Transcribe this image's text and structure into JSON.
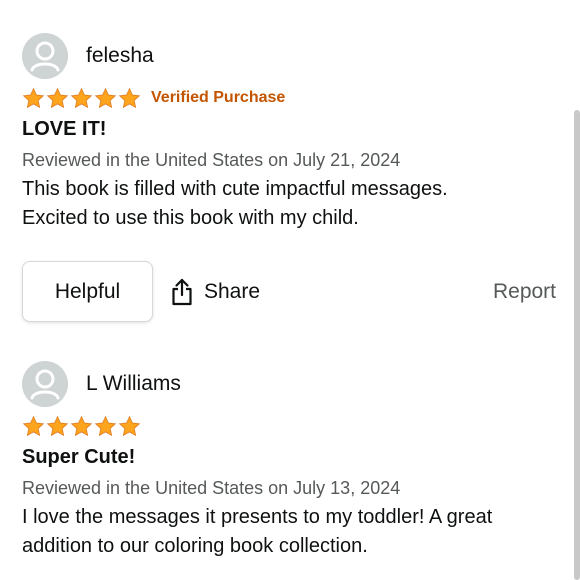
{
  "reviews": [
    {
      "author": "felesha",
      "rating": 5,
      "badge": "Verified Purchase",
      "title": "LOVE IT!",
      "meta": "Reviewed in the United States on July 21, 2024",
      "body": [
        "This book is filled with cute impactful messages.",
        "Excited to use this book with my child."
      ]
    },
    {
      "author": "L Williams",
      "rating": 5,
      "badge": "",
      "title": "Super Cute!",
      "meta": "Reviewed in the United States on July 13, 2024",
      "body": [
        "I love the messages it presents to my toddler! A great",
        "addition to our coloring book collection."
      ]
    }
  ],
  "actions": {
    "helpful_label": "Helpful",
    "share_label": "Share",
    "report_label": "Report"
  },
  "colors": {
    "star": "#ffa41c",
    "verified": "#c45500",
    "meta": "#565959"
  },
  "icons": {
    "avatar": "person-silhouette-icon",
    "star": "star-icon",
    "share": "share-icon"
  }
}
